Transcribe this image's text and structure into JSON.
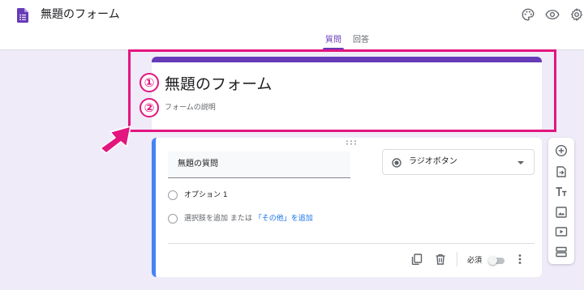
{
  "header": {
    "title": "無題のフォーム",
    "icons": [
      "form-doc-icon",
      "palette-icon",
      "eye-icon",
      "gear-icon"
    ]
  },
  "tabs": [
    {
      "label": "質問",
      "active": true
    },
    {
      "label": "回答",
      "active": false
    }
  ],
  "form": {
    "title": "無題のフォーム",
    "description_placeholder": "フォームの説明"
  },
  "callouts": {
    "one": "①",
    "two": "②"
  },
  "question": {
    "title": "無題の質問",
    "type_label": "ラジオボタン",
    "options": [
      {
        "label": "オプション 1"
      }
    ],
    "add_option": {
      "label": "選択肢を追加",
      "or": "または",
      "other_link": "「その他」を追加"
    },
    "required_label": "必須",
    "required": false
  },
  "side_toolbar": {
    "icons": [
      "add-circle-icon",
      "import-icon",
      "title-text-icon",
      "image-icon",
      "video-icon",
      "section-icon"
    ]
  },
  "colors": {
    "accent": "#673ab7",
    "highlight": "#e3157f",
    "active_border": "#4285f4",
    "link": "#1a73e8",
    "background": "#efebf8"
  }
}
